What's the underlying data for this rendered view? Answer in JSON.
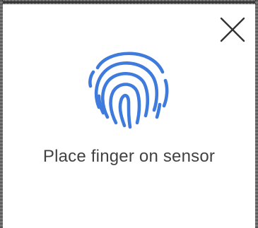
{
  "dialog": {
    "prompt_text": "Place finger on sensor",
    "close_icon": "close-icon",
    "fingerprint_icon": "fingerprint-icon",
    "accent_color": "#3f7bdc",
    "close_color": "#333333"
  }
}
